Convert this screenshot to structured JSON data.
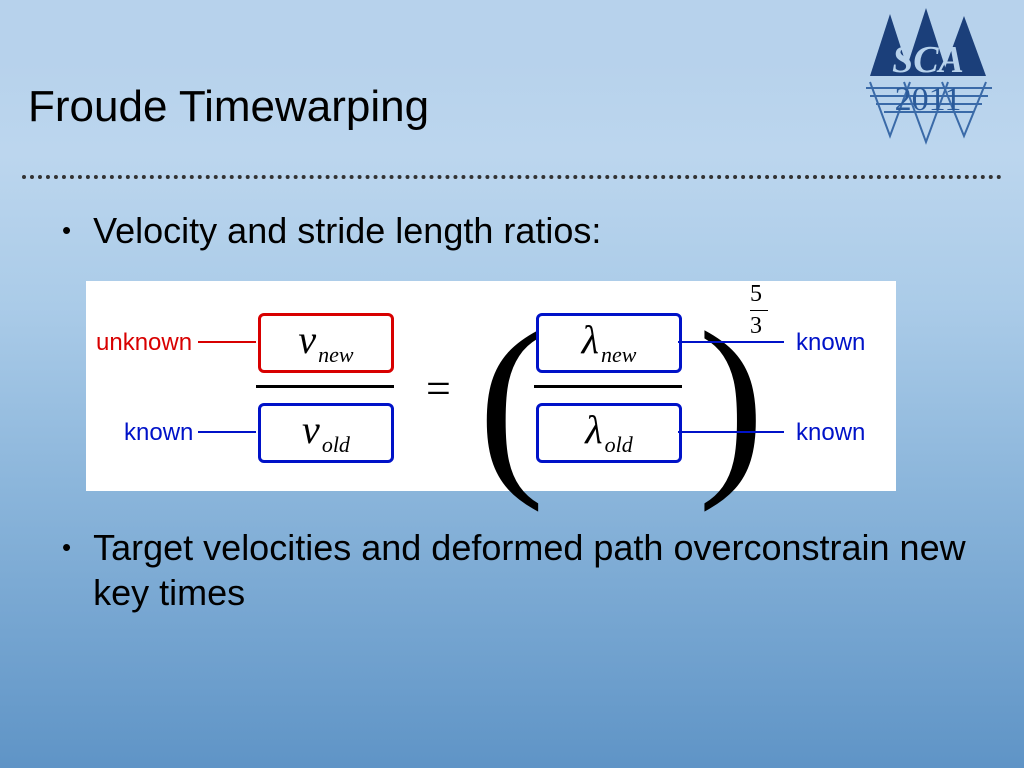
{
  "logo": {
    "text_top": "SCA",
    "text_bottom": "2011"
  },
  "title": "Froude Timewarping",
  "bullets": [
    "Velocity and stride length ratios:",
    "Target velocities and deformed path overconstrain new key times"
  ],
  "equation": {
    "labels": {
      "unknown": "unknown",
      "known": "known"
    },
    "terms": {
      "v_new_base": "v",
      "v_new_sub": "new",
      "v_old_base": "v",
      "v_old_sub": "old",
      "l_new_base": "λ",
      "l_new_sub": "new",
      "l_old_base": "λ",
      "l_old_sub": "old"
    },
    "operator": "=",
    "exponent_num": "5",
    "exponent_den": "3"
  }
}
